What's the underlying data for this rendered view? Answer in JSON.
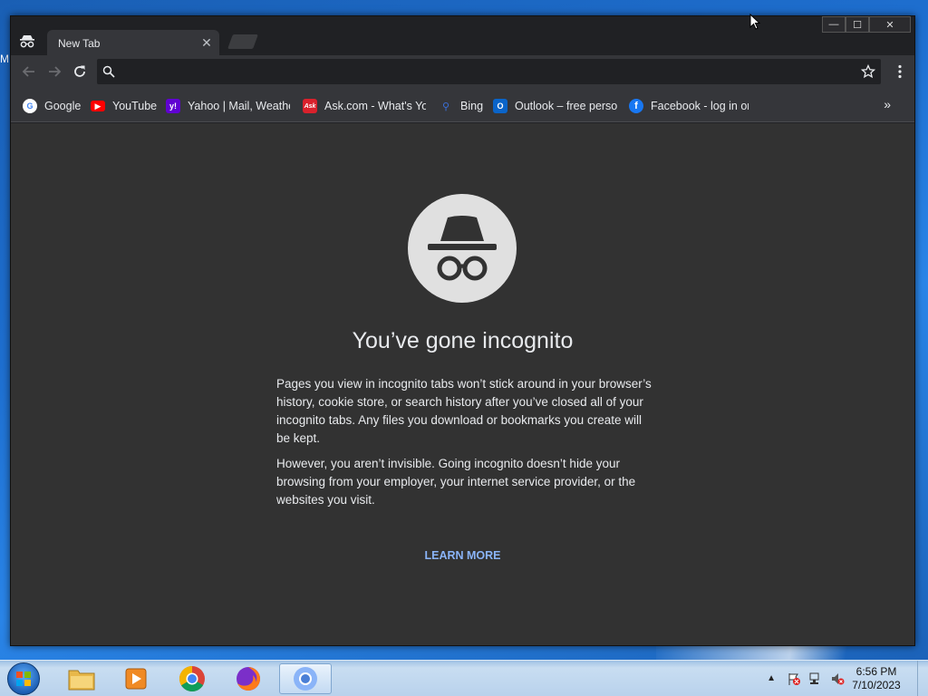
{
  "desktop": {
    "edge_letter": "M"
  },
  "tab": {
    "title": "New Tab",
    "close_glyph": "✕"
  },
  "window_controls": {
    "minimize": "—",
    "maximize": "☐",
    "close": "✕"
  },
  "omnibox": {
    "value": "",
    "placeholder": ""
  },
  "bookmarks": {
    "items": [
      {
        "label": "Google",
        "icon": "google-icon",
        "color": "#ffffff"
      },
      {
        "label": "YouTube",
        "icon": "youtube-icon",
        "color": "#ff0000"
      },
      {
        "label": "Yahoo | Mail, Weathe",
        "icon": "yahoo-icon",
        "color": "#6001d2"
      },
      {
        "label": "Ask.com - What's You",
        "icon": "ask-icon",
        "color": "#d9212c"
      },
      {
        "label": "Bing",
        "icon": "bing-icon",
        "color": "#3a6fd8"
      },
      {
        "label": "Outlook – free persor",
        "icon": "outlook-icon",
        "color": "#0a64c9"
      },
      {
        "label": "Facebook - log in or",
        "icon": "facebook-icon",
        "color": "#1877f2"
      }
    ],
    "more_glyph": "»"
  },
  "incognito_page": {
    "headline": "You’ve gone incognito",
    "paragraph1": "Pages you view in incognito tabs won’t stick around in your browser’s history, cookie store, or search history after you’ve closed all of your incognito tabs. Any files you download or bookmarks you create will be kept.",
    "paragraph2": "However, you aren’t invisible. Going incognito doesn’t hide your browsing from your employer, your internet service provider, or the websites you visit.",
    "learn_more": "LEARN MORE"
  },
  "colors": {
    "frame": "#202124",
    "toolbar": "#35363a",
    "content": "#323232",
    "link": "#8ab4f8"
  },
  "taskbar": {
    "apps": [
      {
        "name": "file-explorer",
        "icon": "folder-icon",
        "active": false
      },
      {
        "name": "media-player",
        "icon": "media-player-icon",
        "active": false
      },
      {
        "name": "chrome",
        "icon": "chrome-icon",
        "active": false
      },
      {
        "name": "firefox",
        "icon": "firefox-icon",
        "active": false
      },
      {
        "name": "chromium",
        "icon": "chromium-icon",
        "active": true
      }
    ],
    "tray_arrow": "▲",
    "time": "6:56 PM",
    "date": "7/10/2023"
  }
}
